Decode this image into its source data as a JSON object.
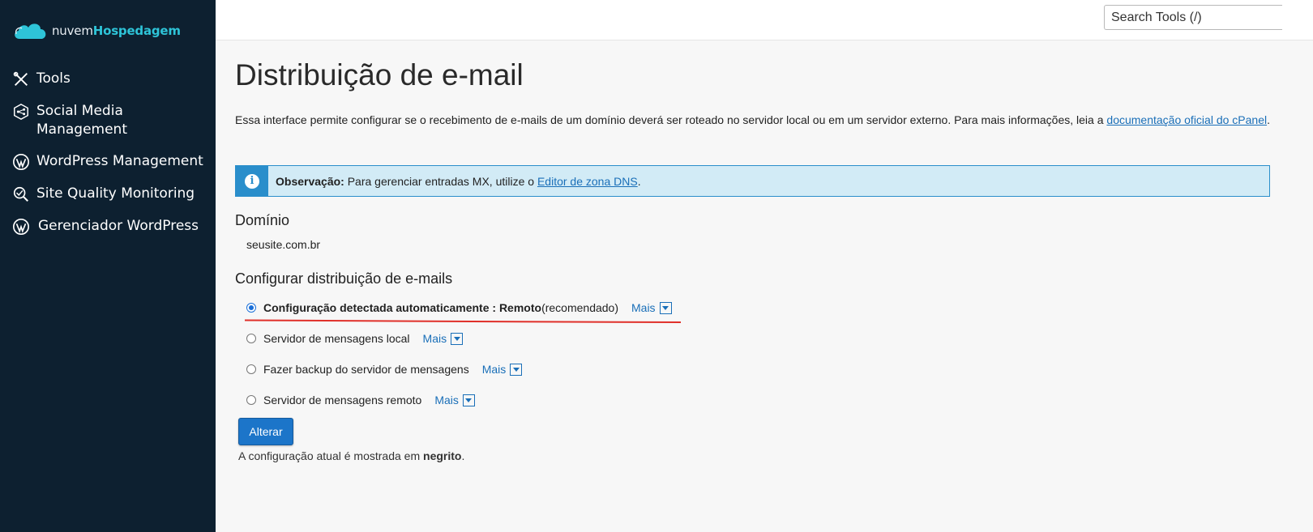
{
  "brand": {
    "name_part1": "nuvem",
    "name_part2": "Hospedagem",
    "accent": "#2ec4d8",
    "sidebar_bg": "#0d2030"
  },
  "sidebar": {
    "items": [
      {
        "label": "Tools",
        "icon": "tools-icon"
      },
      {
        "label": "Social Media Management",
        "icon": "social-media-icon"
      },
      {
        "label": "WordPress Management",
        "icon": "wordpress-icon"
      },
      {
        "label": "Site Quality Monitoring",
        "icon": "search-quality-icon"
      },
      {
        "label": "Gerenciador WordPress",
        "icon": "wordpress-icon"
      }
    ]
  },
  "topbar": {
    "search_placeholder": "Search Tools (/)"
  },
  "page": {
    "title": "Distribuição de e-mail",
    "intro_text": "Essa interface permite configurar se o recebimento de e-mails de um domínio deverá ser roteado no servidor local ou em um servidor externo. Para mais informações, leia a ",
    "intro_link": "documentação oficial do cPanel",
    "intro_end": ".",
    "alert": {
      "bold": "Observação:",
      "text": " Para gerenciar entradas MX, utilize o ",
      "link": "Editor de zona DNS",
      "end": "."
    },
    "domain_heading": "Domínio",
    "domain_value": "seusite.com.br",
    "config_heading": "Configurar distribuição de e-mails",
    "options": [
      {
        "label_bold": "Configuração detectada automaticamente : Remoto",
        "label_suffix": " (recomendado)",
        "checked": true,
        "more": "Mais"
      },
      {
        "label": "Servidor de mensagens local",
        "checked": false,
        "more": "Mais"
      },
      {
        "label": "Fazer backup do servidor de mensagens",
        "checked": false,
        "more": "Mais"
      },
      {
        "label": "Servidor de mensagens remoto",
        "checked": false,
        "more": "Mais"
      }
    ],
    "submit_label": "Alterar",
    "footer_note_prefix": "A configuração atual é mostrada em ",
    "footer_note_bold": "negrito",
    "footer_note_end": "."
  }
}
